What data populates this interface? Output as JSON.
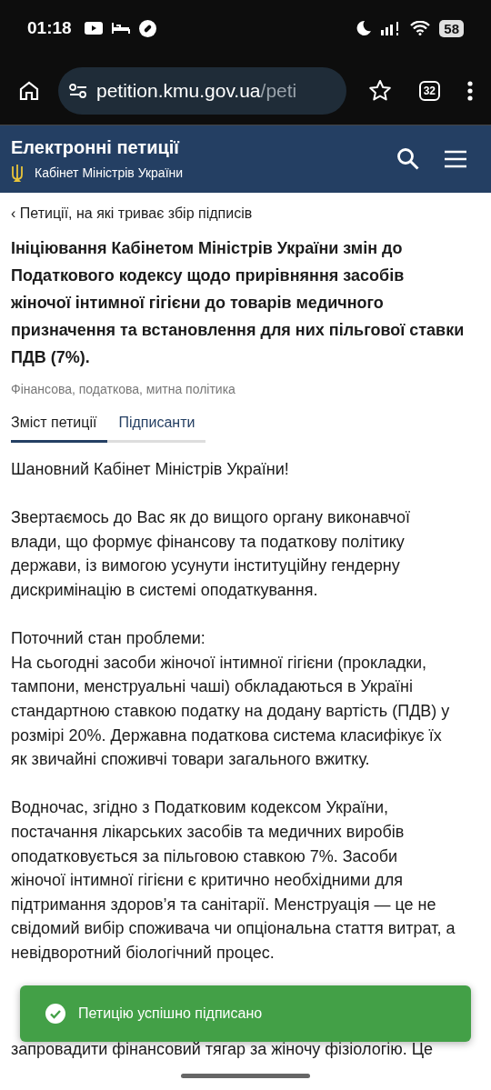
{
  "status_bar": {
    "time": "01:18",
    "battery": "58"
  },
  "browser": {
    "url_host": "petition.kmu.gov.ua",
    "url_path": "/peti",
    "tab_count": "32"
  },
  "site_header": {
    "title": "Електронні петиції",
    "subtitle": "Кабінет Міністрів України"
  },
  "back_link": {
    "arrow": "‹",
    "label": "Петиції, на які триває збір підписів"
  },
  "petition": {
    "title": "Ініціювання Кабінетом Міністрів України змін до\nПодаткового кодексу щодо прирівняння засобів\nжіночої інтимної гігієни до товарів медичного\nпризначення та встановлення для них пільгової ставки\nПДВ (7%).",
    "category": "Фінансова, податкова, митна політика"
  },
  "tabs": [
    {
      "label": "Зміст петиції",
      "selected": true
    },
    {
      "label": "Підписанти",
      "selected": false
    }
  ],
  "body": [
    "Шановний Кабінет Міністрів України!",
    "Звертаємось до Вас як до вищого органу виконавчої\nвлади, що формує фінансову та податкову політику\nдержави, із вимогою усунути інституційну гендерну\nдискримінацію в системі оподаткування.",
    "Поточний стан проблеми:\nНа сьогодні засоби жіночої інтимної гігієни (прокладки,\nтампони, менструальні чаші) обкладаються в Україні\nстандартною ставкою податку на додану вартість (ПДВ) у\nрозмірі 20%. Державна податкова система класифікує їх\nяк звичайні споживчі товари загального вжитку.",
    "Водночас, згідно з Податковим кодексом України,\nпостачання лікарських засобів та медичних виробів\nоподатковується за пільговою ставкою 7%. Засоби\nжіночої інтимної гігієни є критично необхідними для\nпідтримання здоров’я та санітарії. Менструація — це не\nсвідомий вибір споживача чи опціональна стаття витрат, а\nневідворотний біологічний процес."
  ],
  "last_line": "запровадити фінансовий тягар за жіночу фізіологію. Це",
  "toast": {
    "message": "Петицію успішно підписано"
  }
}
